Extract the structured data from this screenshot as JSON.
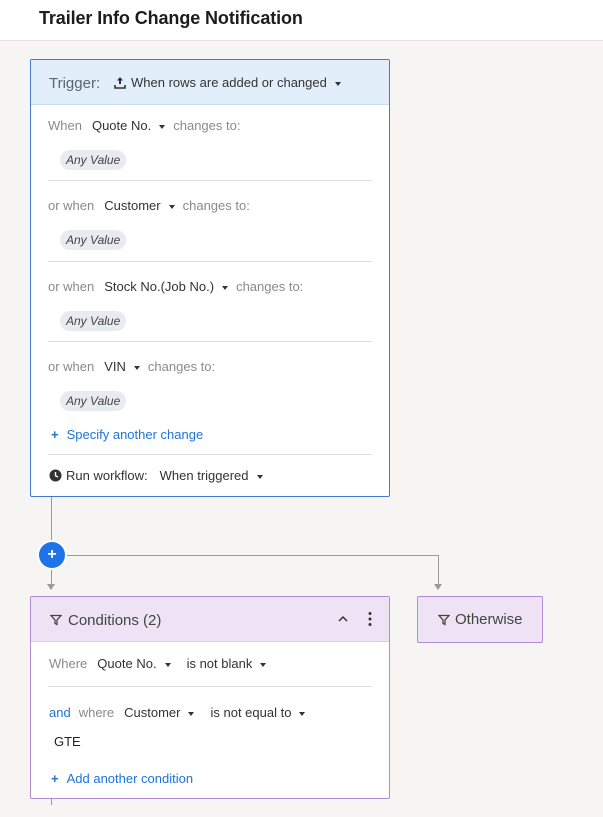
{
  "header": {
    "title": "Trailer Info Change Notification"
  },
  "trigger": {
    "label": "Trigger:",
    "value": "When rows are added or changed",
    "conditions": [
      {
        "prefix": "When",
        "field": "Quote No.",
        "suffix": "changes to:",
        "pill": "Any Value"
      },
      {
        "prefix": "or when",
        "field": "Customer",
        "suffix": "changes to:",
        "pill": "Any Value"
      },
      {
        "prefix": "or when",
        "field": "Stock No.(Job No.)",
        "suffix": "changes to:",
        "pill": "Any Value"
      },
      {
        "prefix": "or when",
        "field": "VIN",
        "suffix": "changes to:",
        "pill": "Any Value"
      }
    ],
    "add_change": "Specify another change",
    "run_label": "Run workflow:",
    "run_value": "When triggered"
  },
  "conditions": {
    "title": "Conditions (2)",
    "rows": [
      {
        "where": "Where",
        "field": "Quote No.",
        "operator": "is not blank"
      },
      {
        "and": "and",
        "where": "where",
        "field": "Customer",
        "operator": "is not equal to",
        "value": "GTE"
      }
    ],
    "add_condition": "Add another condition"
  },
  "otherwise": {
    "label": "Otherwise"
  },
  "add_step": {
    "symbol": "+"
  },
  "colors": {
    "accent": "#1e73e8",
    "trigger_border": "#3e7bd1",
    "trigger_header": "#e3eefb",
    "conditions_border": "#b38ad0",
    "conditions_header": "#ede3f4"
  }
}
